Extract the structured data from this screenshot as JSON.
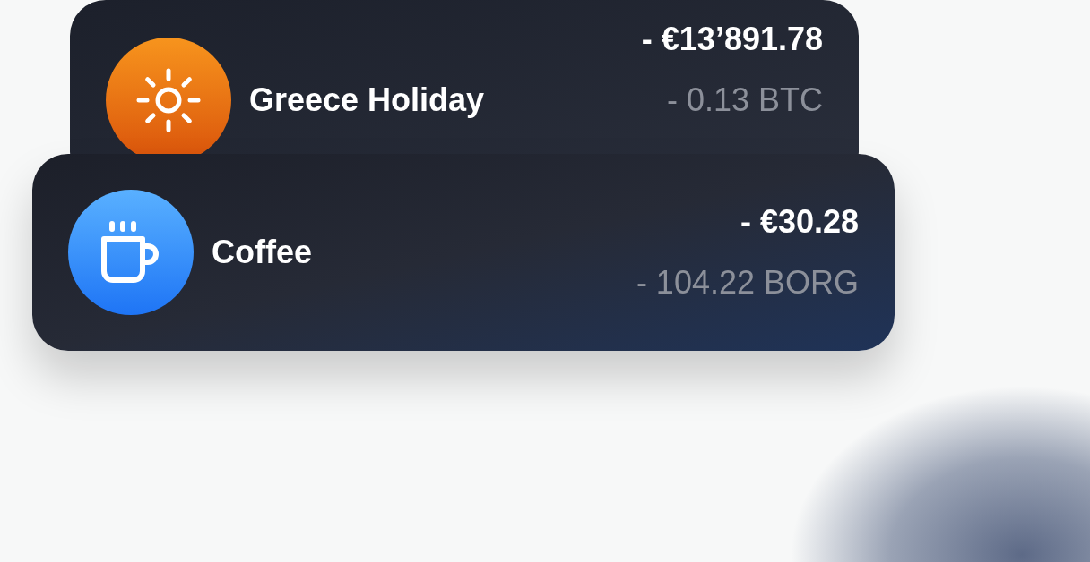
{
  "transactions": [
    {
      "kind": "sun",
      "title": "Greece Holiday",
      "amount": "- €13’891.78",
      "crypto": "- 0.13 BTC"
    },
    {
      "kind": "cup",
      "title": "Coffee",
      "amount": "- €30.28",
      "crypto": "- 104.22 BORG"
    }
  ]
}
